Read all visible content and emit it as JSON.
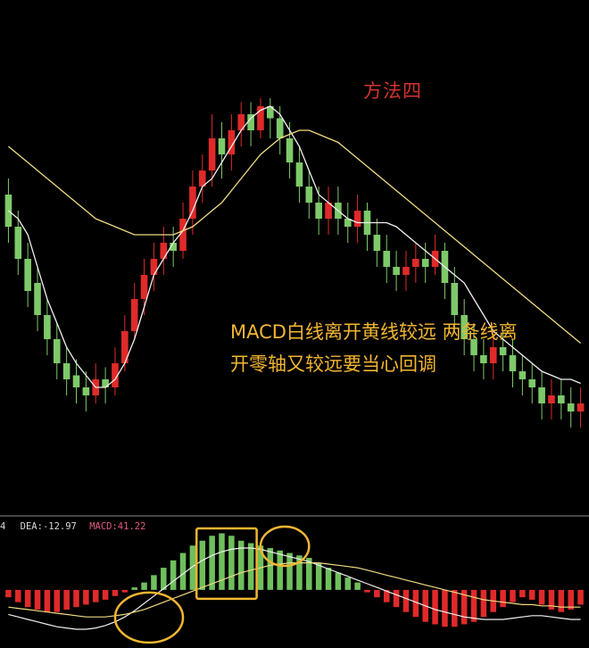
{
  "title": "方法四",
  "annotation": {
    "line1": "MACD白线离开黄线较远 两条线离",
    "line2": "开零轴又较远要当心回调"
  },
  "indicator_legend": {
    "lead": "4",
    "dea": "DEA:-12.97",
    "macd": "MACD:41.22"
  },
  "colors": {
    "background": "#000000",
    "up_candle": "#e02a2a",
    "down_candle": "#7ec96a",
    "fast_line": "#f0f0f0",
    "slow_line": "#f0dc82",
    "highlight": "#f2b632",
    "title": "#d3342c",
    "hist_up": "#6fbf5c",
    "hist_down": "#e02a2a"
  },
  "chart_data": [
    {
      "type": "candlestick",
      "ylim": [
        0,
        100
      ],
      "series": [
        {
          "values": [
            72,
            70,
            66,
            58,
            50,
            44,
            38,
            34,
            31,
            28,
            28,
            30,
            34,
            40,
            48,
            56,
            60,
            64,
            67,
            72,
            78,
            80,
            84,
            88,
            92,
            95,
            97,
            98,
            96,
            92,
            88,
            82,
            76,
            74,
            72,
            70,
            69,
            69,
            69,
            69,
            68,
            66,
            64,
            62,
            60,
            58,
            56,
            54,
            50,
            46,
            42,
            40,
            38,
            36,
            34,
            32,
            31,
            30,
            30,
            29
          ]
        },
        {
          "values": [
            88,
            86,
            84,
            82,
            80,
            78,
            76,
            74,
            72,
            70,
            69,
            68,
            67,
            66,
            66,
            66,
            66,
            66,
            67,
            68,
            70,
            72,
            74,
            77,
            80,
            83,
            86,
            88,
            90,
            91,
            92,
            92,
            91,
            90,
            89,
            87,
            85,
            83,
            81,
            79,
            77,
            75,
            73,
            71,
            69,
            67,
            65,
            63,
            61,
            59,
            57,
            55,
            53,
            51,
            49,
            47,
            45,
            43,
            41,
            39
          ]
        }
      ],
      "candles": [
        {
          "o": 76,
          "c": 68,
          "h": 80,
          "l": 64
        },
        {
          "o": 68,
          "c": 60,
          "h": 72,
          "l": 56
        },
        {
          "o": 60,
          "c": 52,
          "h": 64,
          "l": 48
        },
        {
          "o": 54,
          "c": 46,
          "h": 58,
          "l": 42
        },
        {
          "o": 46,
          "c": 40,
          "h": 50,
          "l": 36
        },
        {
          "o": 40,
          "c": 34,
          "h": 44,
          "l": 30
        },
        {
          "o": 34,
          "c": 30,
          "h": 38,
          "l": 26
        },
        {
          "o": 31,
          "c": 28,
          "h": 35,
          "l": 24
        },
        {
          "o": 28,
          "c": 26,
          "h": 32,
          "l": 22
        },
        {
          "o": 26,
          "c": 30,
          "h": 34,
          "l": 24
        },
        {
          "o": 30,
          "c": 28,
          "h": 33,
          "l": 24
        },
        {
          "o": 28,
          "c": 34,
          "h": 38,
          "l": 26
        },
        {
          "o": 34,
          "c": 42,
          "h": 46,
          "l": 32
        },
        {
          "o": 42,
          "c": 50,
          "h": 54,
          "l": 40
        },
        {
          "o": 50,
          "c": 56,
          "h": 60,
          "l": 46
        },
        {
          "o": 56,
          "c": 60,
          "h": 64,
          "l": 52
        },
        {
          "o": 60,
          "c": 64,
          "h": 68,
          "l": 56
        },
        {
          "o": 64,
          "c": 62,
          "h": 68,
          "l": 58
        },
        {
          "o": 62,
          "c": 70,
          "h": 74,
          "l": 60
        },
        {
          "o": 70,
          "c": 78,
          "h": 82,
          "l": 66
        },
        {
          "o": 78,
          "c": 82,
          "h": 86,
          "l": 74
        },
        {
          "o": 82,
          "c": 90,
          "h": 96,
          "l": 78
        },
        {
          "o": 90,
          "c": 86,
          "h": 94,
          "l": 80
        },
        {
          "o": 86,
          "c": 92,
          "h": 96,
          "l": 82
        },
        {
          "o": 92,
          "c": 96,
          "h": 99,
          "l": 88
        },
        {
          "o": 96,
          "c": 92,
          "h": 99,
          "l": 88
        },
        {
          "o": 92,
          "c": 98,
          "h": 100,
          "l": 90
        },
        {
          "o": 98,
          "c": 95,
          "h": 100,
          "l": 90
        },
        {
          "o": 95,
          "c": 90,
          "h": 98,
          "l": 86
        },
        {
          "o": 90,
          "c": 84,
          "h": 94,
          "l": 80
        },
        {
          "o": 84,
          "c": 78,
          "h": 88,
          "l": 74
        },
        {
          "o": 78,
          "c": 74,
          "h": 82,
          "l": 70
        },
        {
          "o": 74,
          "c": 70,
          "h": 78,
          "l": 66
        },
        {
          "o": 70,
          "c": 74,
          "h": 78,
          "l": 66
        },
        {
          "o": 74,
          "c": 70,
          "h": 78,
          "l": 66
        },
        {
          "o": 70,
          "c": 68,
          "h": 74,
          "l": 64
        },
        {
          "o": 68,
          "c": 72,
          "h": 76,
          "l": 64
        },
        {
          "o": 72,
          "c": 66,
          "h": 74,
          "l": 62
        },
        {
          "o": 66,
          "c": 62,
          "h": 70,
          "l": 58
        },
        {
          "o": 62,
          "c": 58,
          "h": 66,
          "l": 54
        },
        {
          "o": 58,
          "c": 56,
          "h": 62,
          "l": 52
        },
        {
          "o": 56,
          "c": 58,
          "h": 62,
          "l": 52
        },
        {
          "o": 58,
          "c": 60,
          "h": 64,
          "l": 54
        },
        {
          "o": 60,
          "c": 58,
          "h": 64,
          "l": 54
        },
        {
          "o": 58,
          "c": 62,
          "h": 66,
          "l": 56
        },
        {
          "o": 62,
          "c": 54,
          "h": 64,
          "l": 50
        },
        {
          "o": 54,
          "c": 46,
          "h": 58,
          "l": 42
        },
        {
          "o": 46,
          "c": 40,
          "h": 50,
          "l": 36
        },
        {
          "o": 40,
          "c": 36,
          "h": 44,
          "l": 32
        },
        {
          "o": 36,
          "c": 34,
          "h": 40,
          "l": 30
        },
        {
          "o": 34,
          "c": 38,
          "h": 42,
          "l": 30
        },
        {
          "o": 38,
          "c": 36,
          "h": 42,
          "l": 32
        },
        {
          "o": 36,
          "c": 32,
          "h": 40,
          "l": 28
        },
        {
          "o": 32,
          "c": 30,
          "h": 36,
          "l": 26
        },
        {
          "o": 30,
          "c": 28,
          "h": 34,
          "l": 24
        },
        {
          "o": 28,
          "c": 24,
          "h": 32,
          "l": 20
        },
        {
          "o": 24,
          "c": 26,
          "h": 30,
          "l": 20
        },
        {
          "o": 26,
          "c": 24,
          "h": 30,
          "l": 20
        },
        {
          "o": 24,
          "c": 22,
          "h": 28,
          "l": 18
        },
        {
          "o": 22,
          "c": 24,
          "h": 28,
          "l": 18
        }
      ]
    },
    {
      "type": "bar",
      "ylim": [
        -40,
        50
      ],
      "values": [
        -6,
        -10,
        -14,
        -16,
        -18,
        -18,
        -16,
        -14,
        -12,
        -10,
        -8,
        -5,
        -2,
        2,
        6,
        12,
        18,
        24,
        30,
        36,
        40,
        44,
        46,
        44,
        40,
        38,
        36,
        34,
        32,
        30,
        28,
        26,
        22,
        18,
        14,
        10,
        6,
        -2,
        -6,
        -10,
        -14,
        -18,
        -22,
        -26,
        -28,
        -30,
        -30,
        -28,
        -26,
        -22,
        -18,
        -14,
        -10,
        -6,
        -8,
        -12,
        -16,
        -18,
        -16,
        -12
      ],
      "series": [
        {
          "values": [
            -20,
            -22,
            -24,
            -26,
            -28,
            -30,
            -31,
            -32,
            -32,
            -31,
            -29,
            -26,
            -22,
            -17,
            -11,
            -5,
            1,
            7,
            13,
            19,
            24,
            28,
            31,
            33,
            34,
            34,
            33,
            31,
            29,
            27,
            25,
            23,
            20,
            17,
            14,
            11,
            8,
            5,
            2,
            -1,
            -4,
            -7,
            -10,
            -13,
            -16,
            -18,
            -20,
            -22,
            -23,
            -24,
            -24,
            -24,
            -23,
            -22,
            -21,
            -21,
            -22,
            -23,
            -24,
            -24
          ]
        },
        {
          "values": [
            -14,
            -15,
            -16,
            -17,
            -18,
            -19,
            -20,
            -21,
            -22,
            -22,
            -22,
            -21,
            -20,
            -18,
            -16,
            -13,
            -10,
            -7,
            -4,
            -1,
            2,
            5,
            8,
            11,
            14,
            16,
            18,
            20,
            21,
            22,
            22,
            22,
            22,
            21,
            20,
            19,
            18,
            16,
            14,
            12,
            10,
            8,
            6,
            4,
            2,
            0,
            -2,
            -4,
            -6,
            -8,
            -9,
            -10,
            -11,
            -12,
            -12,
            -13,
            -13,
            -14,
            -14,
            -14
          ]
        }
      ],
      "highlights": [
        {
          "shape": "ellipse",
          "from_index": 12,
          "to_index": 17
        },
        {
          "shape": "rect",
          "from_index": 20,
          "to_index": 25
        },
        {
          "shape": "ellipse",
          "from_index": 27,
          "to_index": 30
        }
      ]
    }
  ]
}
